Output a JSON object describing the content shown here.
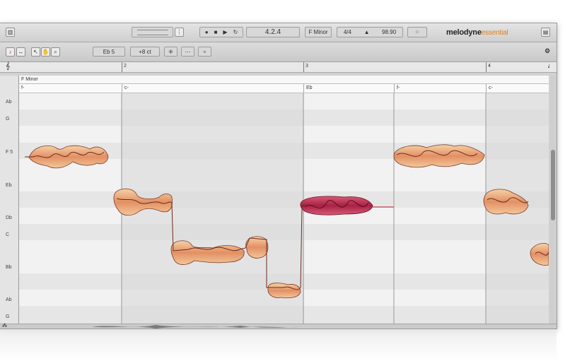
{
  "transport": {
    "position": "4.2.4",
    "key": "F Minor",
    "time_signature": "4/4",
    "tempo": "98.90"
  },
  "brand": {
    "name": "melodyne",
    "edition": "essential"
  },
  "toolbar": {
    "pitch_value": "Eb 5",
    "cent_value": "+8 ct"
  },
  "ruler": {
    "bars": [
      "2",
      "3",
      "4"
    ]
  },
  "scale_label": "F Minor",
  "chords": [
    "f-",
    "c-",
    "Eb",
    "f-",
    "c-"
  ],
  "pitch_lanes": [
    "Ab",
    "G",
    "F 5",
    "Eb",
    "Db",
    "C",
    "Bb",
    "Ab",
    "G"
  ],
  "colors": {
    "blob_warm": "#e9a56d",
    "blob_active": "#c63a5a",
    "window_bg": "#d2d2d2",
    "accent": "#e07d1f"
  }
}
